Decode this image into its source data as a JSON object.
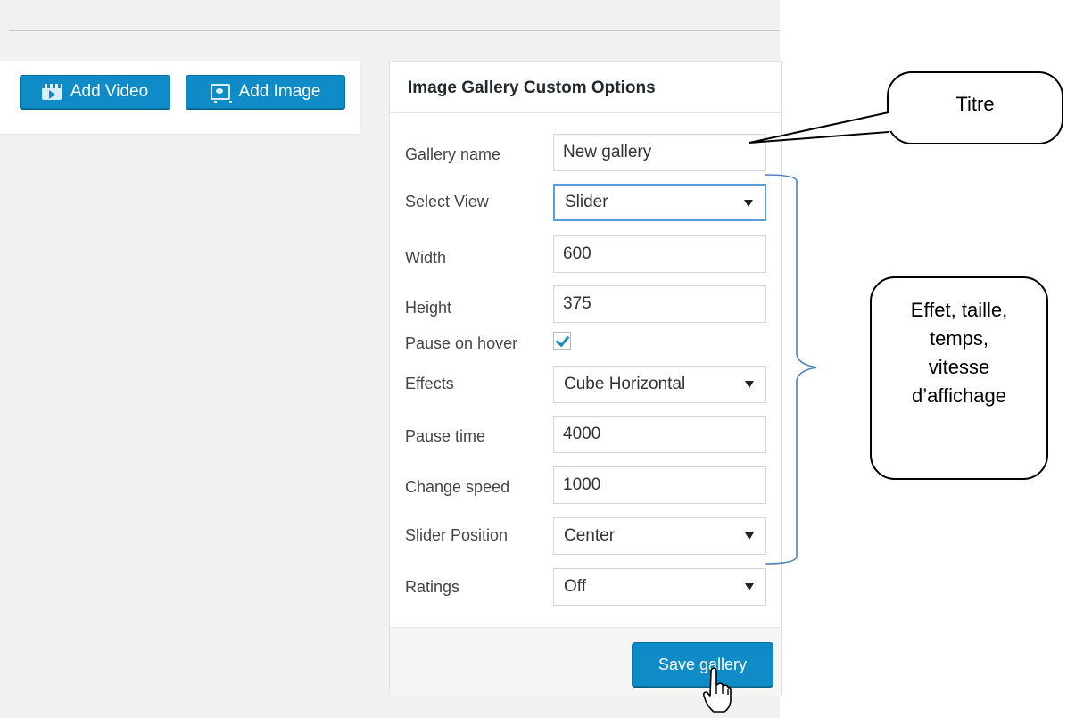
{
  "toolbar": {
    "add_video_label": "Add Video",
    "add_image_label": "Add Image",
    "add_video_icon": "video-clapper-icon",
    "add_image_icon": "image-icon"
  },
  "panel": {
    "title": "Image Gallery Custom Options",
    "fields": {
      "gallery_name": {
        "label": "Gallery name",
        "value": "New gallery"
      },
      "select_view": {
        "label": "Select View",
        "selected": "Slider"
      },
      "width": {
        "label": "Width",
        "value": "600"
      },
      "height": {
        "label": "Height",
        "value": "375"
      },
      "pause_on_hover": {
        "label": "Pause on hover",
        "checked": true
      },
      "effects": {
        "label": "Effects",
        "selected": "Cube Horizontal"
      },
      "pause_time": {
        "label": "Pause time",
        "value": "4000"
      },
      "change_speed": {
        "label": "Change speed",
        "value": "1000"
      },
      "slider_position": {
        "label": "Slider Position",
        "selected": "Center"
      },
      "ratings": {
        "label": "Ratings",
        "selected": "Off"
      }
    },
    "save_label": "Save gallery"
  },
  "annotations": {
    "titre": "Titre",
    "effet_lines": [
      "Effet, taille,",
      "temps,",
      "vitesse",
      "d’affichage"
    ]
  },
  "colors": {
    "button_blue": "#0f8cc7",
    "focus_border": "#5b9dd9",
    "bracket_blue": "#4f81bd",
    "check_blue": "#1e8cbe"
  }
}
